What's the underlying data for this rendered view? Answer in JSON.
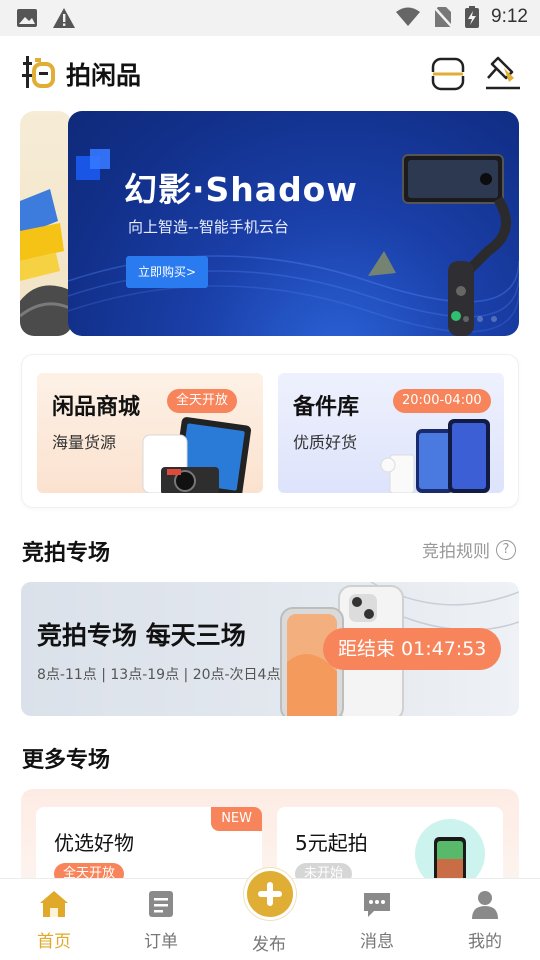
{
  "status_bar": {
    "time": "9:12"
  },
  "header": {
    "app_title": "拍闲品"
  },
  "banner": {
    "title": "幻影·Shadow",
    "subtitle": "向上智造--智能手机云台",
    "cta": "立即购买>"
  },
  "categories": [
    {
      "title": "闲品商城",
      "subtitle": "海量货源",
      "badge": "全天开放"
    },
    {
      "title": "备件库",
      "subtitle": "优质好货",
      "badge": "20:00-04:00"
    }
  ],
  "auction_section": {
    "heading": "竞拍专场",
    "rules_label": "竞拍规则",
    "banner_title": "竞拍专场  每天三场",
    "schedule": "8点-11点 | 13点-19点 | 20点-次日4点",
    "countdown": "距结束 01:47:53"
  },
  "more_section": {
    "heading": "更多专场",
    "cards": [
      {
        "title": "优选好物",
        "tag": "NEW",
        "status": "全天开放"
      },
      {
        "title": "5元起拍",
        "status": "未开始"
      }
    ]
  },
  "tabbar": {
    "items": [
      {
        "label": "首页",
        "icon": "home-icon",
        "active": true
      },
      {
        "label": "订单",
        "icon": "order-icon"
      },
      {
        "label": "发布",
        "icon": "plus-icon"
      },
      {
        "label": "消息",
        "icon": "message-icon"
      },
      {
        "label": "我的",
        "icon": "profile-icon"
      }
    ]
  },
  "colors": {
    "accent": "#e0ae34",
    "badge": "#f7845a",
    "banner_blue": "#12308a"
  }
}
